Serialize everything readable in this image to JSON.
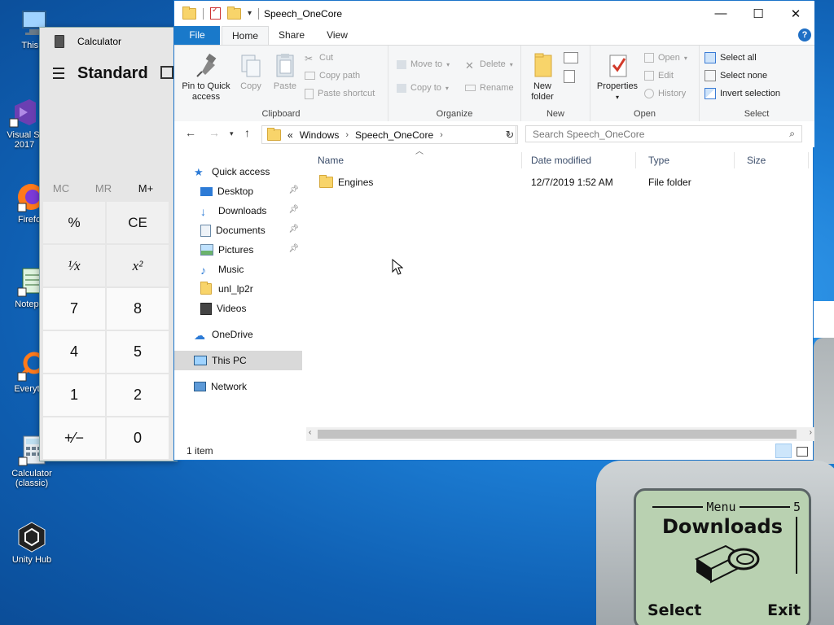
{
  "desktop": {
    "icons": [
      {
        "label": "This PC",
        "label_visible": "This P"
      },
      {
        "label_line1": "Visual St",
        "label_line2": "2017"
      },
      {
        "label": "Firefo"
      },
      {
        "label": "Notepa"
      },
      {
        "label": "Everyth"
      },
      {
        "label_line1": "Calculator",
        "label_line2": "(classic)"
      },
      {
        "label": "Unity Hub"
      }
    ]
  },
  "calculator": {
    "title": "Calculator",
    "mode": "Standard",
    "memory": [
      "MC",
      "MR",
      "M+"
    ],
    "keys": [
      "%",
      "CE",
      "¹⁄x",
      "x²",
      "7",
      "8",
      "4",
      "5",
      "1",
      "2",
      "+⁄−",
      "0"
    ]
  },
  "explorer": {
    "title": "Speech_OneCore",
    "tabs": [
      "File",
      "Home",
      "Share",
      "View"
    ],
    "help": "?",
    "ribbon": {
      "clipboard": {
        "label": "Clipboard",
        "pin": "Pin to Quick access",
        "pin_line1": "Pin to Quick",
        "pin_line2": "access",
        "copy": "Copy",
        "paste": "Paste",
        "cut": "Cut",
        "copy_path": "Copy path",
        "paste_shortcut": "Paste shortcut"
      },
      "organize": {
        "label": "Organize",
        "move_to": "Move to",
        "copy_to": "Copy to",
        "delete": "Delete",
        "rename": "Rename"
      },
      "new": {
        "label": "New",
        "new_folder_line1": "New",
        "new_folder_line2": "folder"
      },
      "open": {
        "label": "Open",
        "properties": "Properties",
        "open": "Open",
        "edit": "Edit",
        "history": "History"
      },
      "select": {
        "label": "Select",
        "select_all": "Select all",
        "select_none": "Select none",
        "invert": "Invert selection"
      }
    },
    "address": {
      "overflow": "«",
      "crumbs": [
        "Windows",
        "Speech_OneCore"
      ],
      "search_placeholder": "Search Speech_OneCore"
    },
    "nav": {
      "quick_access": "Quick access",
      "items": [
        "Desktop",
        "Downloads",
        "Documents",
        "Pictures",
        "Music",
        "unl_lp2r",
        "Videos"
      ],
      "onedrive": "OneDrive",
      "this_pc": "This PC",
      "network": "Network"
    },
    "columns": [
      "Name",
      "Date modified",
      "Type",
      "Size"
    ],
    "files": [
      {
        "name": "Engines",
        "date": "12/7/2019 1:52 AM",
        "type": "File folder",
        "size": ""
      }
    ],
    "status": "1 item"
  },
  "phone": {
    "menu": "Menu",
    "number": "5",
    "title": "Downloads",
    "left_soft": "Select",
    "right_soft": "Exit"
  },
  "colors": {
    "accent": "#1979ca",
    "desktop": "#1d7fd6",
    "lcd": "#b9d1b1"
  }
}
